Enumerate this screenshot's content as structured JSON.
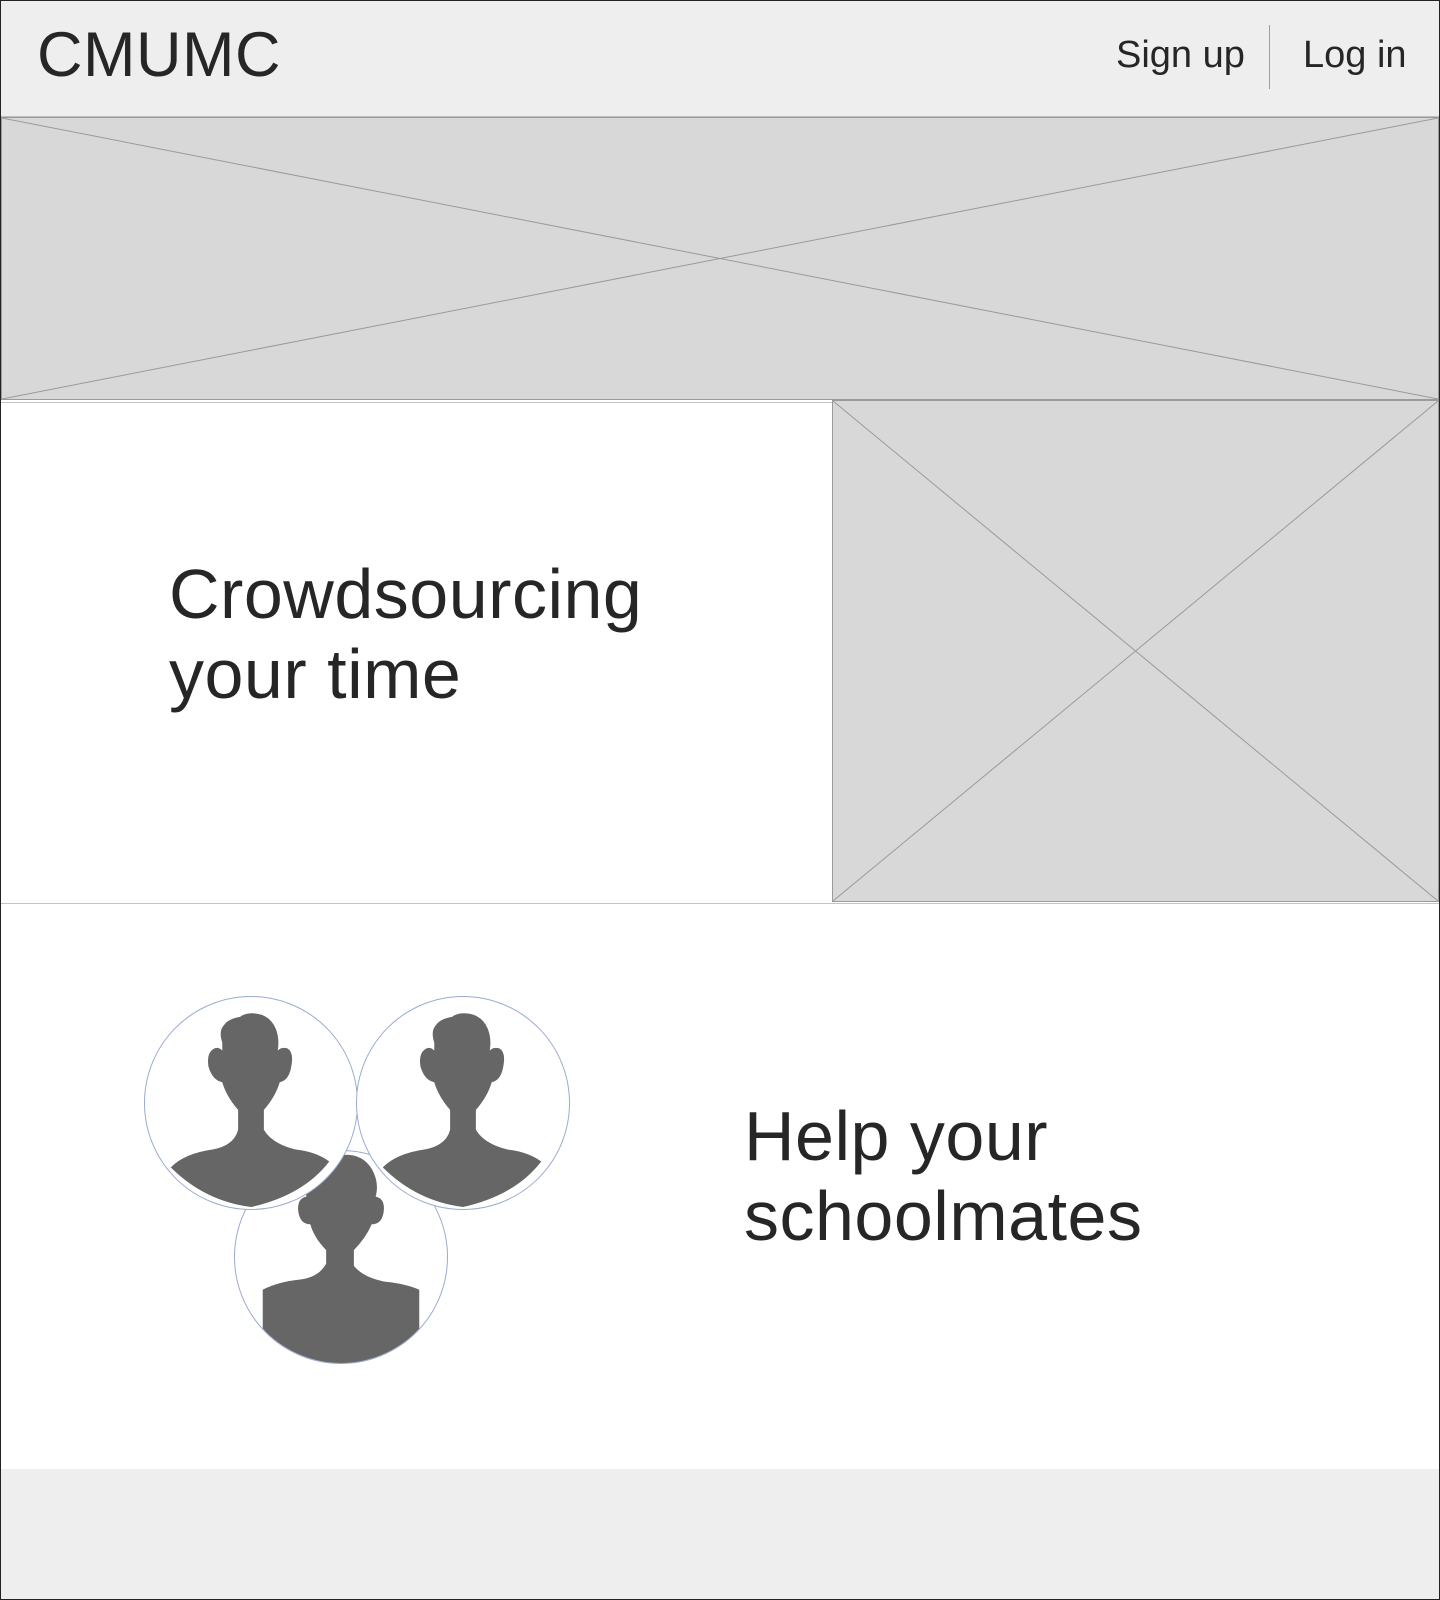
{
  "header": {
    "logo": "CMUMC",
    "nav": {
      "signup_label": "Sign up",
      "login_label": "Log in"
    }
  },
  "sections": {
    "feature_one": {
      "heading_lines": [
        "Crowdsourcing",
        "your time"
      ]
    },
    "feature_two": {
      "heading_lines": [
        "Help your",
        "schoolmates"
      ]
    }
  },
  "icons": {
    "avatar": "person-silhouette-icon",
    "image_placeholder": "image-placeholder-icon"
  },
  "colors": {
    "header_bg": "#eeeeee",
    "placeholder_bg": "#d8d8d8",
    "silhouette": "#666666",
    "text": "#262626"
  }
}
